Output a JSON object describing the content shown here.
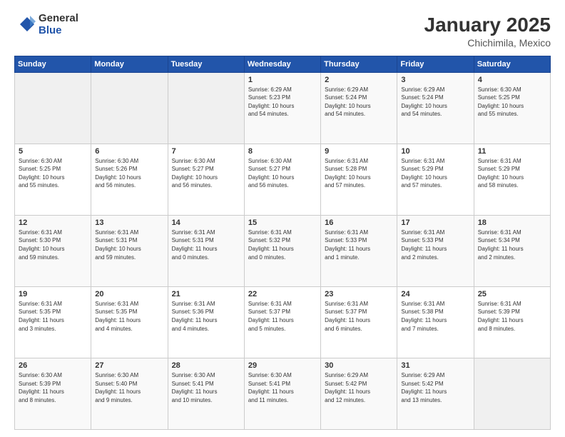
{
  "header": {
    "logo_general": "General",
    "logo_blue": "Blue",
    "title": "January 2025",
    "subtitle": "Chichimila, Mexico"
  },
  "weekdays": [
    "Sunday",
    "Monday",
    "Tuesday",
    "Wednesday",
    "Thursday",
    "Friday",
    "Saturday"
  ],
  "weeks": [
    [
      {
        "day": "",
        "info": ""
      },
      {
        "day": "",
        "info": ""
      },
      {
        "day": "",
        "info": ""
      },
      {
        "day": "1",
        "info": "Sunrise: 6:29 AM\nSunset: 5:23 PM\nDaylight: 10 hours\nand 54 minutes."
      },
      {
        "day": "2",
        "info": "Sunrise: 6:29 AM\nSunset: 5:24 PM\nDaylight: 10 hours\nand 54 minutes."
      },
      {
        "day": "3",
        "info": "Sunrise: 6:29 AM\nSunset: 5:24 PM\nDaylight: 10 hours\nand 54 minutes."
      },
      {
        "day": "4",
        "info": "Sunrise: 6:30 AM\nSunset: 5:25 PM\nDaylight: 10 hours\nand 55 minutes."
      }
    ],
    [
      {
        "day": "5",
        "info": "Sunrise: 6:30 AM\nSunset: 5:25 PM\nDaylight: 10 hours\nand 55 minutes."
      },
      {
        "day": "6",
        "info": "Sunrise: 6:30 AM\nSunset: 5:26 PM\nDaylight: 10 hours\nand 56 minutes."
      },
      {
        "day": "7",
        "info": "Sunrise: 6:30 AM\nSunset: 5:27 PM\nDaylight: 10 hours\nand 56 minutes."
      },
      {
        "day": "8",
        "info": "Sunrise: 6:30 AM\nSunset: 5:27 PM\nDaylight: 10 hours\nand 56 minutes."
      },
      {
        "day": "9",
        "info": "Sunrise: 6:31 AM\nSunset: 5:28 PM\nDaylight: 10 hours\nand 57 minutes."
      },
      {
        "day": "10",
        "info": "Sunrise: 6:31 AM\nSunset: 5:29 PM\nDaylight: 10 hours\nand 57 minutes."
      },
      {
        "day": "11",
        "info": "Sunrise: 6:31 AM\nSunset: 5:29 PM\nDaylight: 10 hours\nand 58 minutes."
      }
    ],
    [
      {
        "day": "12",
        "info": "Sunrise: 6:31 AM\nSunset: 5:30 PM\nDaylight: 10 hours\nand 59 minutes."
      },
      {
        "day": "13",
        "info": "Sunrise: 6:31 AM\nSunset: 5:31 PM\nDaylight: 10 hours\nand 59 minutes."
      },
      {
        "day": "14",
        "info": "Sunrise: 6:31 AM\nSunset: 5:31 PM\nDaylight: 11 hours\nand 0 minutes."
      },
      {
        "day": "15",
        "info": "Sunrise: 6:31 AM\nSunset: 5:32 PM\nDaylight: 11 hours\nand 0 minutes."
      },
      {
        "day": "16",
        "info": "Sunrise: 6:31 AM\nSunset: 5:33 PM\nDaylight: 11 hours\nand 1 minute."
      },
      {
        "day": "17",
        "info": "Sunrise: 6:31 AM\nSunset: 5:33 PM\nDaylight: 11 hours\nand 2 minutes."
      },
      {
        "day": "18",
        "info": "Sunrise: 6:31 AM\nSunset: 5:34 PM\nDaylight: 11 hours\nand 2 minutes."
      }
    ],
    [
      {
        "day": "19",
        "info": "Sunrise: 6:31 AM\nSunset: 5:35 PM\nDaylight: 11 hours\nand 3 minutes."
      },
      {
        "day": "20",
        "info": "Sunrise: 6:31 AM\nSunset: 5:35 PM\nDaylight: 11 hours\nand 4 minutes."
      },
      {
        "day": "21",
        "info": "Sunrise: 6:31 AM\nSunset: 5:36 PM\nDaylight: 11 hours\nand 4 minutes."
      },
      {
        "day": "22",
        "info": "Sunrise: 6:31 AM\nSunset: 5:37 PM\nDaylight: 11 hours\nand 5 minutes."
      },
      {
        "day": "23",
        "info": "Sunrise: 6:31 AM\nSunset: 5:37 PM\nDaylight: 11 hours\nand 6 minutes."
      },
      {
        "day": "24",
        "info": "Sunrise: 6:31 AM\nSunset: 5:38 PM\nDaylight: 11 hours\nand 7 minutes."
      },
      {
        "day": "25",
        "info": "Sunrise: 6:31 AM\nSunset: 5:39 PM\nDaylight: 11 hours\nand 8 minutes."
      }
    ],
    [
      {
        "day": "26",
        "info": "Sunrise: 6:30 AM\nSunset: 5:39 PM\nDaylight: 11 hours\nand 8 minutes."
      },
      {
        "day": "27",
        "info": "Sunrise: 6:30 AM\nSunset: 5:40 PM\nDaylight: 11 hours\nand 9 minutes."
      },
      {
        "day": "28",
        "info": "Sunrise: 6:30 AM\nSunset: 5:41 PM\nDaylight: 11 hours\nand 10 minutes."
      },
      {
        "day": "29",
        "info": "Sunrise: 6:30 AM\nSunset: 5:41 PM\nDaylight: 11 hours\nand 11 minutes."
      },
      {
        "day": "30",
        "info": "Sunrise: 6:29 AM\nSunset: 5:42 PM\nDaylight: 11 hours\nand 12 minutes."
      },
      {
        "day": "31",
        "info": "Sunrise: 6:29 AM\nSunset: 5:42 PM\nDaylight: 11 hours\nand 13 minutes."
      },
      {
        "day": "",
        "info": ""
      }
    ]
  ]
}
